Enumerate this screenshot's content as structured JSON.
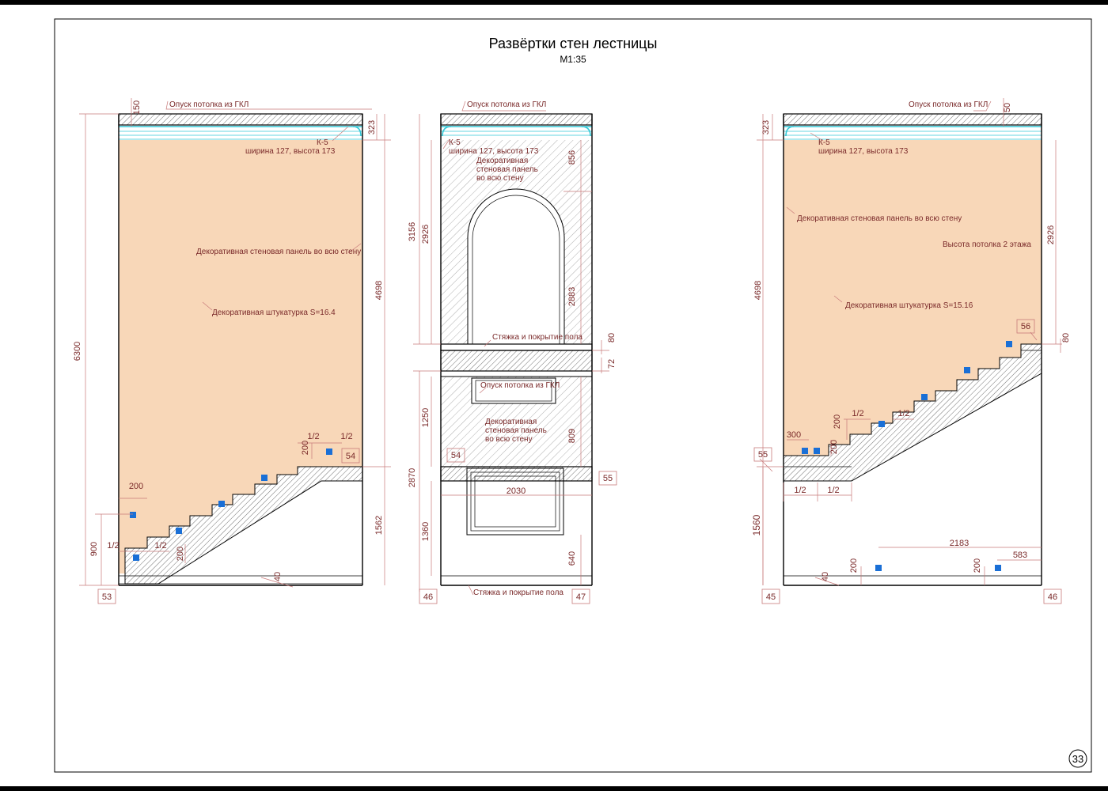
{
  "sheet": {
    "title": "Развёртки стен лестницы",
    "scale": "М1:35",
    "page_number": "33"
  },
  "colors": {
    "plaster_fill": "#f8d7b8",
    "dimension": "#c87a7a",
    "text": "#7a2a2a",
    "cornice": "#33c7d6",
    "socket": "#1a6fd6"
  },
  "left_wall": {
    "notes": {
      "ceiling": "Опуск потолка из ГКЛ",
      "cornice_name": "К-5",
      "cornice_size": "ширина 127, высота 173",
      "panel": "Декоративная стеновая панель во всю стену",
      "plaster": "Декоративная штукатурка  S=16.4"
    },
    "dims": {
      "total_height": "6300",
      "ceiling_drop": "150",
      "cornice_zone": "323",
      "upper_height": "4698",
      "lower_height": "1562",
      "floor": "40",
      "h900": "900",
      "w200_top": "200",
      "h200_a": "200",
      "h200_b": "200",
      "half_a": "1/2",
      "half_b": "1/2",
      "half_c": "1/2",
      "half_d": "1/2"
    },
    "tags": {
      "bottom_left": "53",
      "step_tag": "54"
    }
  },
  "middle_wall": {
    "notes": {
      "ceiling": "Опуск потолка из ГКЛ",
      "cornice_name": "К-5",
      "cornice_size": "ширина 127, высота 173",
      "panel_line1": "Декоративная",
      "panel_line2": "стеновая панель",
      "panel_line3": "во всю стену",
      "screed_top": "Стяжка и  покрытие пола",
      "ceiling_mid": "Опуск потолка из ГКЛ",
      "panel2_line1": "Декоративная",
      "panel2_line2": "стеновая панель",
      "panel2_line3": "во всю стену",
      "screed_bottom": "Стяжка и  покрытие пола"
    },
    "dims": {
      "h3156": "3156",
      "h2926": "2926",
      "h856": "856",
      "h2883": "2883",
      "h80": "80",
      "h72": "72",
      "h2870": "2870",
      "h1250": "1250",
      "h809": "809",
      "w2030": "2030",
      "h1360": "1360",
      "h640": "640"
    },
    "tags": {
      "tag_54": "54",
      "tag_55": "55",
      "tag_46": "46",
      "tag_47": "47"
    }
  },
  "right_wall": {
    "notes": {
      "ceiling": "Опуск потолка из ГКЛ",
      "cornice_name": "К-5",
      "cornice_size": "ширина 127, высота 173",
      "panel": "Декоративная стеновая панель во всю стену",
      "ceiling_height": "Высота потолка 2 этажа",
      "plaster": "Декоративная штукатурка  S=15.16"
    },
    "dims": {
      "h323": "323",
      "h50": "50",
      "h4698": "4698",
      "h2926": "2926",
      "h80": "80",
      "w300": "300",
      "h200_a": "200",
      "h200_b": "200",
      "half_a": "1/2",
      "half_b": "1/2",
      "half_c": "1/2",
      "half_d": "1/2",
      "h1560": "1560",
      "w2183": "2183",
      "w583": "583",
      "floor": "40",
      "h200_c": "200",
      "h200_d": "200"
    },
    "tags": {
      "tag_56": "56",
      "tag_55": "55",
      "tag_45": "45",
      "tag_46": "46"
    }
  }
}
